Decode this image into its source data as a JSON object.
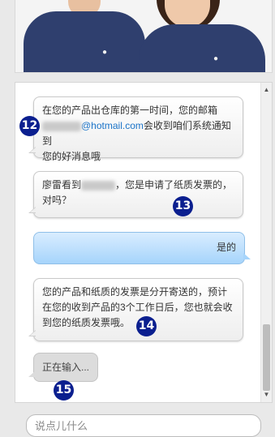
{
  "banner": {
    "logo_left": "",
    "logo_right": ""
  },
  "messages": [
    {
      "role": "agent",
      "line1": "在您的产品出仓库的第一时间，您的邮箱",
      "email_blur": "xxxxxxxx",
      "email_domain": "@hotmail.com",
      "line2_rest": "会收到咱们系统通知到",
      "line3": "您的好消息哦",
      "badge": "12"
    },
    {
      "role": "agent",
      "prefix": "廖雷看到",
      "name_blur": "xxxxxx",
      "suffix": "，您是申请了纸质发票的，",
      "line2": "对吗？",
      "badge": "13"
    },
    {
      "role": "user",
      "text": "是的"
    },
    {
      "role": "agent",
      "line1": "您的产品和纸质的发票是分开寄送的，预计",
      "line2": "在您的收到产品的3个工作日后，您也就会收",
      "line3": "到您的纸质发票哦。",
      "badge": "14"
    },
    {
      "role": "agent-typing",
      "text": "正在输入...",
      "badge": "15"
    }
  ],
  "input": {
    "placeholder": "说点儿什么"
  },
  "colors": {
    "badge": "#0b1f8f",
    "user_bubble": "#a6d4fb",
    "email_link": "#1a73c8"
  }
}
